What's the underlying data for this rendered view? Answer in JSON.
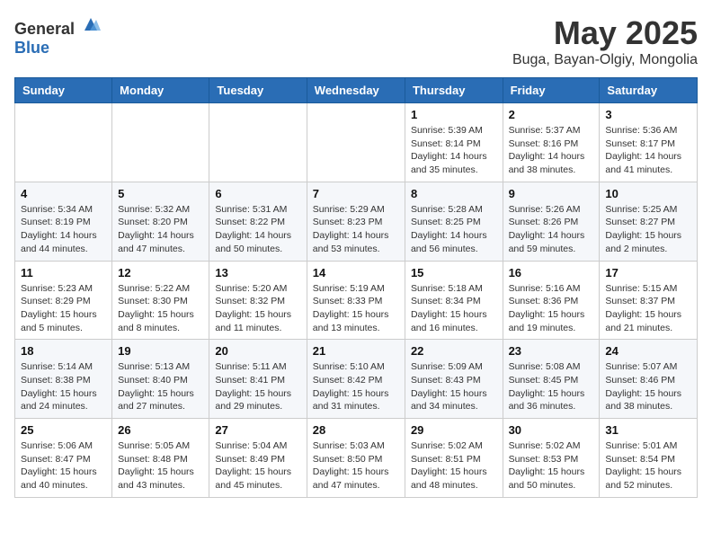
{
  "header": {
    "logo_general": "General",
    "logo_blue": "Blue",
    "month": "May 2025",
    "location": "Buga, Bayan-Olgiy, Mongolia"
  },
  "weekdays": [
    "Sunday",
    "Monday",
    "Tuesday",
    "Wednesday",
    "Thursday",
    "Friday",
    "Saturday"
  ],
  "weeks": [
    [
      {
        "day": "",
        "info": ""
      },
      {
        "day": "",
        "info": ""
      },
      {
        "day": "",
        "info": ""
      },
      {
        "day": "",
        "info": ""
      },
      {
        "day": "1",
        "info": "Sunrise: 5:39 AM\nSunset: 8:14 PM\nDaylight: 14 hours\nand 35 minutes."
      },
      {
        "day": "2",
        "info": "Sunrise: 5:37 AM\nSunset: 8:16 PM\nDaylight: 14 hours\nand 38 minutes."
      },
      {
        "day": "3",
        "info": "Sunrise: 5:36 AM\nSunset: 8:17 PM\nDaylight: 14 hours\nand 41 minutes."
      }
    ],
    [
      {
        "day": "4",
        "info": "Sunrise: 5:34 AM\nSunset: 8:19 PM\nDaylight: 14 hours\nand 44 minutes."
      },
      {
        "day": "5",
        "info": "Sunrise: 5:32 AM\nSunset: 8:20 PM\nDaylight: 14 hours\nand 47 minutes."
      },
      {
        "day": "6",
        "info": "Sunrise: 5:31 AM\nSunset: 8:22 PM\nDaylight: 14 hours\nand 50 minutes."
      },
      {
        "day": "7",
        "info": "Sunrise: 5:29 AM\nSunset: 8:23 PM\nDaylight: 14 hours\nand 53 minutes."
      },
      {
        "day": "8",
        "info": "Sunrise: 5:28 AM\nSunset: 8:25 PM\nDaylight: 14 hours\nand 56 minutes."
      },
      {
        "day": "9",
        "info": "Sunrise: 5:26 AM\nSunset: 8:26 PM\nDaylight: 14 hours\nand 59 minutes."
      },
      {
        "day": "10",
        "info": "Sunrise: 5:25 AM\nSunset: 8:27 PM\nDaylight: 15 hours\nand 2 minutes."
      }
    ],
    [
      {
        "day": "11",
        "info": "Sunrise: 5:23 AM\nSunset: 8:29 PM\nDaylight: 15 hours\nand 5 minutes."
      },
      {
        "day": "12",
        "info": "Sunrise: 5:22 AM\nSunset: 8:30 PM\nDaylight: 15 hours\nand 8 minutes."
      },
      {
        "day": "13",
        "info": "Sunrise: 5:20 AM\nSunset: 8:32 PM\nDaylight: 15 hours\nand 11 minutes."
      },
      {
        "day": "14",
        "info": "Sunrise: 5:19 AM\nSunset: 8:33 PM\nDaylight: 15 hours\nand 13 minutes."
      },
      {
        "day": "15",
        "info": "Sunrise: 5:18 AM\nSunset: 8:34 PM\nDaylight: 15 hours\nand 16 minutes."
      },
      {
        "day": "16",
        "info": "Sunrise: 5:16 AM\nSunset: 8:36 PM\nDaylight: 15 hours\nand 19 minutes."
      },
      {
        "day": "17",
        "info": "Sunrise: 5:15 AM\nSunset: 8:37 PM\nDaylight: 15 hours\nand 21 minutes."
      }
    ],
    [
      {
        "day": "18",
        "info": "Sunrise: 5:14 AM\nSunset: 8:38 PM\nDaylight: 15 hours\nand 24 minutes."
      },
      {
        "day": "19",
        "info": "Sunrise: 5:13 AM\nSunset: 8:40 PM\nDaylight: 15 hours\nand 27 minutes."
      },
      {
        "day": "20",
        "info": "Sunrise: 5:11 AM\nSunset: 8:41 PM\nDaylight: 15 hours\nand 29 minutes."
      },
      {
        "day": "21",
        "info": "Sunrise: 5:10 AM\nSunset: 8:42 PM\nDaylight: 15 hours\nand 31 minutes."
      },
      {
        "day": "22",
        "info": "Sunrise: 5:09 AM\nSunset: 8:43 PM\nDaylight: 15 hours\nand 34 minutes."
      },
      {
        "day": "23",
        "info": "Sunrise: 5:08 AM\nSunset: 8:45 PM\nDaylight: 15 hours\nand 36 minutes."
      },
      {
        "day": "24",
        "info": "Sunrise: 5:07 AM\nSunset: 8:46 PM\nDaylight: 15 hours\nand 38 minutes."
      }
    ],
    [
      {
        "day": "25",
        "info": "Sunrise: 5:06 AM\nSunset: 8:47 PM\nDaylight: 15 hours\nand 40 minutes."
      },
      {
        "day": "26",
        "info": "Sunrise: 5:05 AM\nSunset: 8:48 PM\nDaylight: 15 hours\nand 43 minutes."
      },
      {
        "day": "27",
        "info": "Sunrise: 5:04 AM\nSunset: 8:49 PM\nDaylight: 15 hours\nand 45 minutes."
      },
      {
        "day": "28",
        "info": "Sunrise: 5:03 AM\nSunset: 8:50 PM\nDaylight: 15 hours\nand 47 minutes."
      },
      {
        "day": "29",
        "info": "Sunrise: 5:02 AM\nSunset: 8:51 PM\nDaylight: 15 hours\nand 48 minutes."
      },
      {
        "day": "30",
        "info": "Sunrise: 5:02 AM\nSunset: 8:53 PM\nDaylight: 15 hours\nand 50 minutes."
      },
      {
        "day": "31",
        "info": "Sunrise: 5:01 AM\nSunset: 8:54 PM\nDaylight: 15 hours\nand 52 minutes."
      }
    ]
  ]
}
